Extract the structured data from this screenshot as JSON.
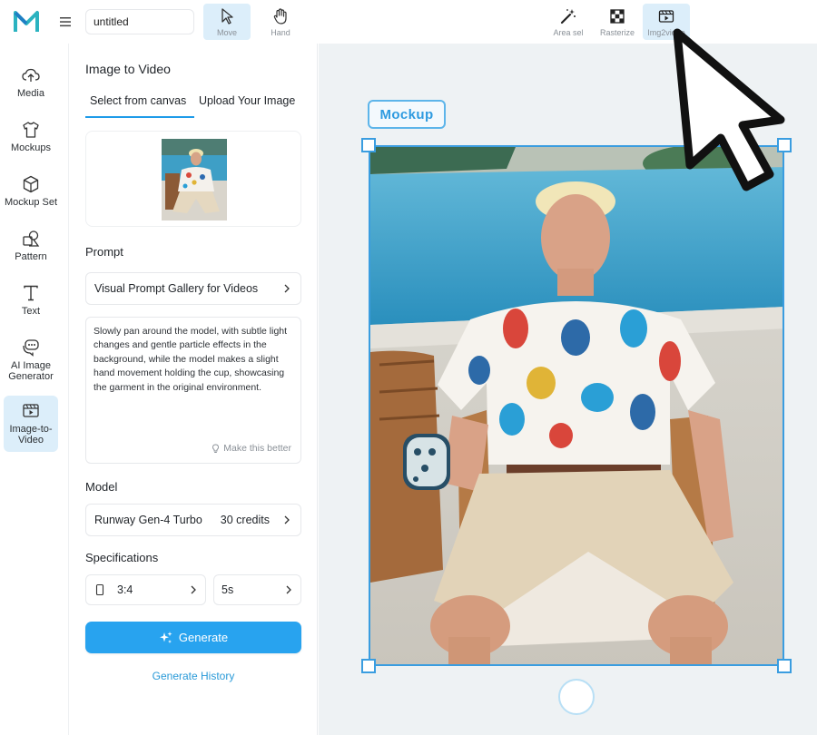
{
  "app": {
    "logo_icon": "logo-m-icon",
    "menu_icon": "hamburger-icon",
    "title_value": "untitled",
    "accent_color": "#28a3ef"
  },
  "toolbar": {
    "move_label": "Move",
    "hand_label": "Hand",
    "area_sel_label": "Area sel",
    "rasterize_label": "Rasterize",
    "img2video_label": "Img2video"
  },
  "sidebar": {
    "items": [
      {
        "label": "Media",
        "icon": "cloud-upload-icon"
      },
      {
        "label": "Mockups",
        "icon": "tshirt-icon"
      },
      {
        "label": "Mockup Set",
        "icon": "cube-icon"
      },
      {
        "label": "Pattern",
        "icon": "pattern-icon"
      },
      {
        "label": "Text",
        "icon": "text-icon"
      },
      {
        "label": "AI Image\nGenerator",
        "icon": "ai-chat-icon"
      },
      {
        "label": "Image-to-\nVideo",
        "icon": "video-icon"
      }
    ]
  },
  "panel": {
    "title": "Image to Video",
    "tabs": [
      "Select from canvas",
      "Upload Your Image"
    ],
    "prompt_label": "Prompt",
    "gallery_label": "Visual Prompt Gallery for Videos",
    "prompt_text": "Slowly pan around the model, with subtle light changes and gentle particle effects in the background, while the model makes a slight hand movement holding the cup, showcasing the garment in the original environment.",
    "make_better_label": "Make this better",
    "model_label": "Model",
    "model_value": "Runway Gen-4 Turbo",
    "model_credits": "30 credits",
    "specs_label": "Specifications",
    "aspect_value": "3:4",
    "duration_value": "5s",
    "generate_label": "Generate",
    "history_label": "Generate History"
  },
  "canvas": {
    "tag_label": "Mockup"
  }
}
